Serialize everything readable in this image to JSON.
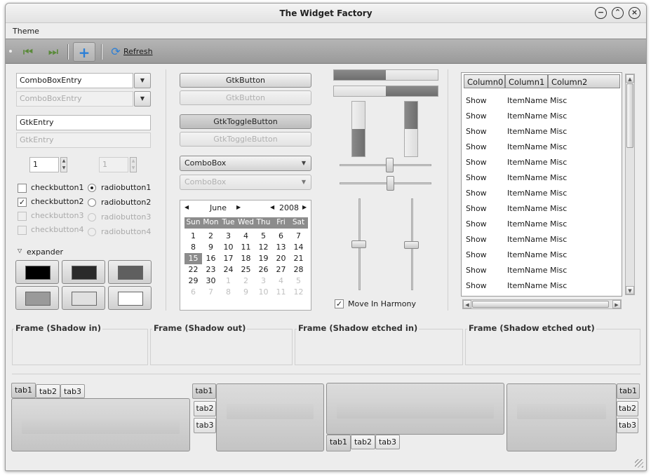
{
  "window": {
    "title": "The Widget Factory"
  },
  "menu": {
    "theme": "Theme"
  },
  "toolbar": {
    "refresh": "Refresh"
  },
  "left": {
    "combo_entry": "ComboBoxEntry",
    "combo_entry_disabled": "ComboBoxEntry",
    "entry": "GtkEntry",
    "entry_disabled": "GtkEntry",
    "spin": "1",
    "spin_disabled": "1",
    "check1": "checkbutton1",
    "check2": "checkbutton2",
    "check3": "checkbutton3",
    "check4": "checkbutton4",
    "radio1": "radiobutton1",
    "radio2": "radiobutton2",
    "radio3": "radiobutton3",
    "radio4": "radiobutton4",
    "expander": "expander",
    "swatch_colors": [
      "#000000",
      "#2a2a2a",
      "#5f5f5f",
      "#9a9a9a",
      "#e0e0e0",
      "#ffffff"
    ]
  },
  "middle": {
    "button": "GtkButton",
    "button_disabled": "GtkButton",
    "toggle": "GtkToggleButton",
    "toggle_disabled": "GtkToggleButton",
    "combo": "ComboBox",
    "combo_disabled": "ComboBox"
  },
  "calendar": {
    "month": "June",
    "year": "2008",
    "weekdays": [
      "Sun",
      "Mon",
      "Tue",
      "Wed",
      "Thu",
      "Fri",
      "Sat"
    ],
    "weeks": [
      [
        "1",
        "2",
        "3",
        "4",
        "5",
        "6",
        "7"
      ],
      [
        "8",
        "9",
        "10",
        "11",
        "12",
        "13",
        "14"
      ],
      [
        "15",
        "16",
        "17",
        "18",
        "19",
        "20",
        "21"
      ],
      [
        "22",
        "23",
        "24",
        "25",
        "26",
        "27",
        "28"
      ],
      [
        "29",
        "30",
        "1",
        "2",
        "3",
        "4",
        "5"
      ],
      [
        "6",
        "7",
        "8",
        "9",
        "10",
        "11",
        "12"
      ]
    ],
    "selected": "15"
  },
  "sliders": {
    "hprog1": 0.5,
    "hprog2": 0.5,
    "vprog1": 0.5,
    "vprog2": 0.5,
    "hscale1": 0.5,
    "hscale2": 0.5,
    "vscale1": 0.5,
    "vscale2": 0.5,
    "harmony_label": "Move In Harmony"
  },
  "tree": {
    "columns": [
      "Column0",
      "Column1",
      "Column2"
    ],
    "rows": [
      [
        "Show",
        "ItemName",
        "Misc"
      ],
      [
        "Show",
        "ItemName",
        "Misc"
      ],
      [
        "Show",
        "ItemName",
        "Misc"
      ],
      [
        "Show",
        "ItemName",
        "Misc"
      ],
      [
        "Show",
        "ItemName",
        "Misc"
      ],
      [
        "Show",
        "ItemName",
        "Misc"
      ],
      [
        "Show",
        "ItemName",
        "Misc"
      ],
      [
        "Show",
        "ItemName",
        "Misc"
      ],
      [
        "Show",
        "ItemName",
        "Misc"
      ],
      [
        "Show",
        "ItemName",
        "Misc"
      ],
      [
        "Show",
        "ItemName",
        "Misc"
      ],
      [
        "Show",
        "ItemName",
        "Misc"
      ],
      [
        "Show",
        "ItemName",
        "Misc"
      ]
    ]
  },
  "frames": [
    "Frame (Shadow in)",
    "Frame (Shadow out)",
    "Frame (Shadow etched in)",
    "Frame (Shadow etched out)"
  ],
  "tabs": [
    "tab1",
    "tab2",
    "tab3"
  ]
}
